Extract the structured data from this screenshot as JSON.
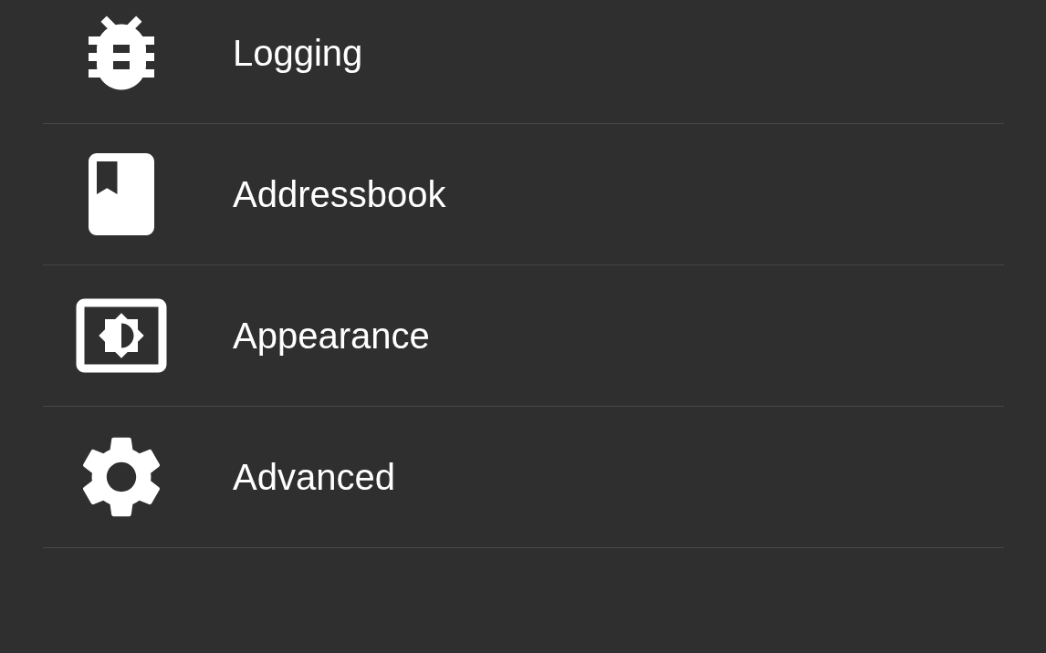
{
  "settings_items": [
    {
      "kind": "bug",
      "label": "Logging"
    },
    {
      "kind": "book",
      "label": "Addressbook"
    },
    {
      "kind": "brightness",
      "label": "Appearance"
    },
    {
      "kind": "gear",
      "label": "Advanced"
    }
  ]
}
